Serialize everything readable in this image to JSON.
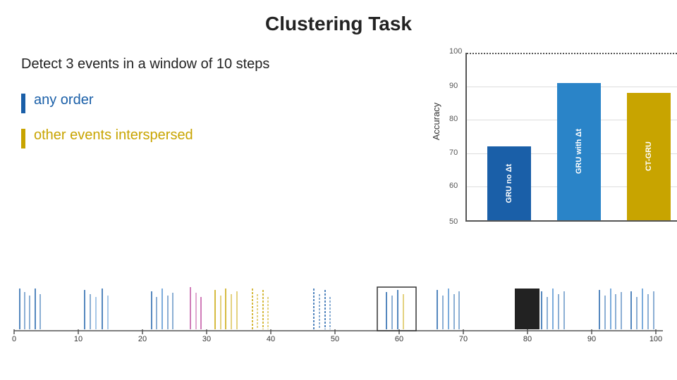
{
  "title": "Clustering Task",
  "detect_text": "Detect 3 events in a window of 10 steps",
  "bullets": [
    {
      "label": "any order",
      "color": "blue"
    },
    {
      "label": "other events interspersed",
      "color": "gold"
    }
  ],
  "chart": {
    "y_label": "Accuracy",
    "y_ticks": [
      50,
      60,
      70,
      80,
      90,
      100
    ],
    "bars": [
      {
        "label": "GRU no Δt",
        "value": 72,
        "color": "#1a5fa8"
      },
      {
        "label": "GRU with Δt",
        "value": 91,
        "color": "#2a84c8"
      },
      {
        "label": "CT-GRU",
        "value": 88,
        "color": "#c8a400"
      }
    ],
    "y_min": 50,
    "y_max": 100
  },
  "timeline": {
    "x_labels": [
      "0",
      "10",
      "20",
      "30",
      "40",
      "50",
      "60",
      "70",
      "80",
      "90",
      "100"
    ]
  }
}
